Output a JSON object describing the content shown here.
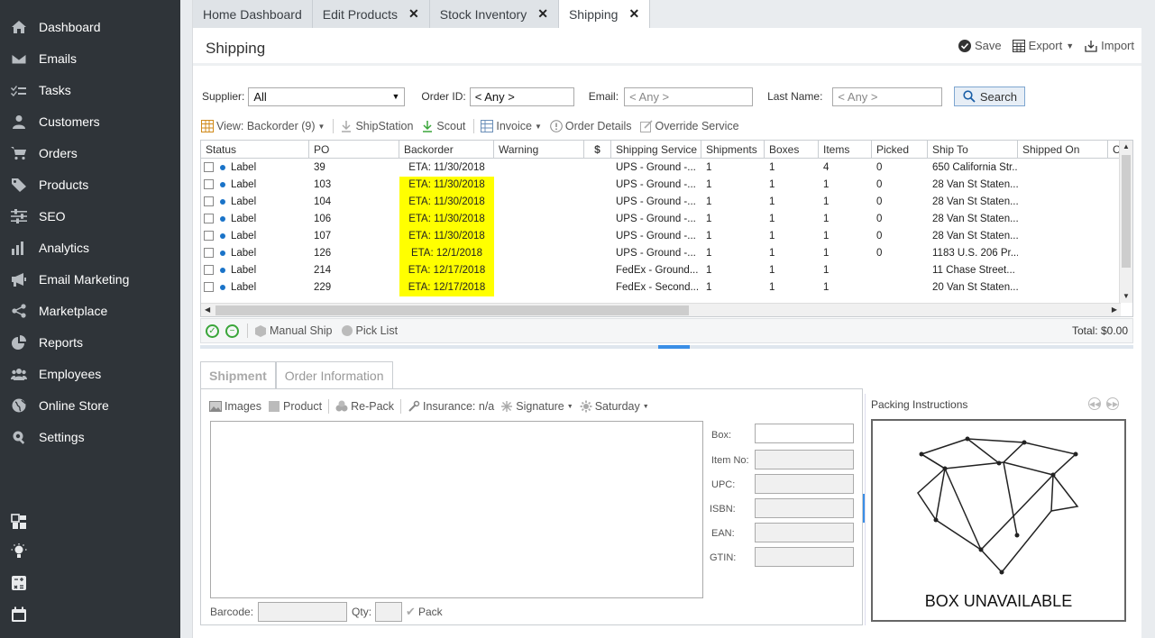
{
  "sidebar": {
    "items": [
      {
        "label": "Dashboard",
        "icon": "home-icon"
      },
      {
        "label": "Emails",
        "icon": "envelope-icon"
      },
      {
        "label": "Tasks",
        "icon": "tasks-icon"
      },
      {
        "label": "Customers",
        "icon": "user-icon"
      },
      {
        "label": "Orders",
        "icon": "cart-icon"
      },
      {
        "label": "Products",
        "icon": "tag-icon"
      },
      {
        "label": "SEO",
        "icon": "sliders-icon"
      },
      {
        "label": "Analytics",
        "icon": "bar-chart-icon"
      },
      {
        "label": "Email Marketing",
        "icon": "megaphone-icon"
      },
      {
        "label": "Marketplace",
        "icon": "share-icon"
      },
      {
        "label": "Reports",
        "icon": "pie-chart-icon"
      },
      {
        "label": "Employees",
        "icon": "users-icon"
      },
      {
        "label": "Online Store",
        "icon": "globe-icon"
      },
      {
        "label": "Settings",
        "icon": "gear-icon"
      }
    ]
  },
  "tabs": [
    {
      "label": "Home Dashboard",
      "closable": false
    },
    {
      "label": "Edit Products",
      "closable": true
    },
    {
      "label": "Stock Inventory",
      "closable": true
    },
    {
      "label": "Shipping",
      "closable": true,
      "active": true
    }
  ],
  "page": {
    "title": "Shipping",
    "actions": {
      "save": "Save",
      "export": "Export",
      "import": "Import"
    }
  },
  "filters": {
    "supplier_label": "Supplier:",
    "supplier_value": "All",
    "order_id_label": "Order ID:",
    "order_id_value": "< Any >",
    "email_label": "Email:",
    "email_value": "< Any >",
    "last_name_label": "Last Name:",
    "last_name_value": "< Any >",
    "search_label": "Search"
  },
  "toolbar": {
    "view": "View: Backorder (9)",
    "shipstation": "ShipStation",
    "scout": "Scout",
    "invoice": "Invoice",
    "order_details": "Order Details",
    "override_service": "Override Service"
  },
  "grid": {
    "columns": [
      "Status",
      "PO",
      "Backorder",
      "Warning",
      "$",
      "Shipping Service",
      "Shipments",
      "Boxes",
      "Items",
      "Picked",
      "Ship To",
      "Shipped On",
      "C"
    ],
    "rows": [
      {
        "status": "Label",
        "po": "39",
        "backorder": "ETA: 11/30/2018",
        "highlight": false,
        "service": "UPS - Ground -...",
        "shipments": "1",
        "boxes": "1",
        "items": "4",
        "picked": "0",
        "ship_to": "650 California Str..."
      },
      {
        "status": "Label",
        "po": "103",
        "backorder": "ETA: 11/30/2018",
        "highlight": true,
        "service": "UPS - Ground -...",
        "shipments": "1",
        "boxes": "1",
        "items": "1",
        "picked": "0",
        "ship_to": "28 Van St  Staten..."
      },
      {
        "status": "Label",
        "po": "104",
        "backorder": "ETA: 11/30/2018",
        "highlight": true,
        "service": "UPS - Ground -...",
        "shipments": "1",
        "boxes": "1",
        "items": "1",
        "picked": "0",
        "ship_to": "28 Van St  Staten..."
      },
      {
        "status": "Label",
        "po": "106",
        "backorder": "ETA: 11/30/2018",
        "highlight": true,
        "service": "UPS - Ground -...",
        "shipments": "1",
        "boxes": "1",
        "items": "1",
        "picked": "0",
        "ship_to": "28 Van St  Staten..."
      },
      {
        "status": "Label",
        "po": "107",
        "backorder": "ETA: 11/30/2018",
        "highlight": true,
        "service": "UPS - Ground -...",
        "shipments": "1",
        "boxes": "1",
        "items": "1",
        "picked": "0",
        "ship_to": "28 Van St  Staten..."
      },
      {
        "status": "Label",
        "po": "126",
        "backorder": "ETA: 12/1/2018",
        "highlight": true,
        "service": "UPS - Ground -...",
        "shipments": "1",
        "boxes": "1",
        "items": "1",
        "picked": "0",
        "ship_to": "1183 U.S. 206  Pr..."
      },
      {
        "status": "Label",
        "po": "214",
        "backorder": "ETA: 12/17/2018",
        "highlight": true,
        "service": "FedEx - Ground...",
        "shipments": "1",
        "boxes": "1",
        "items": "1",
        "picked": "",
        "ship_to": "11 Chase Street..."
      },
      {
        "status": "Label",
        "po": "229",
        "backorder": "ETA: 12/17/2018",
        "highlight": true,
        "service": "FedEx - Second...",
        "shipments": "1",
        "boxes": "1",
        "items": "1",
        "picked": "",
        "ship_to": "20 Van St  Staten..."
      }
    ]
  },
  "grid_footer": {
    "manual_ship": "Manual Ship",
    "pick_list": "Pick List",
    "total": "Total: $0.00"
  },
  "detail": {
    "tabs": [
      "Shipment",
      "Order Information"
    ],
    "toolbar": {
      "images": "Images",
      "product": "Product",
      "repack": "Re-Pack",
      "insurance": "Insurance: n/a",
      "signature": "Signature",
      "saturday": "Saturday"
    },
    "fields": [
      {
        "label": "Box:",
        "top": 0
      },
      {
        "label": "Item No:"
      },
      {
        "label": "UPC:"
      },
      {
        "label": "ISBN:"
      },
      {
        "label": "EAN:"
      },
      {
        "label": "GTIN:"
      }
    ],
    "barcode_label": "Barcode:",
    "qty_label": "Qty:",
    "pack_label": "Pack"
  },
  "packing": {
    "title": "Packing Instructions",
    "unavailable": "BOX UNAVAILABLE"
  },
  "colors": {
    "sidebar_bg": "#2f3439",
    "highlight": "#ffff00",
    "accent": "#3a8ee6",
    "status_dot": "#1a73c8"
  }
}
